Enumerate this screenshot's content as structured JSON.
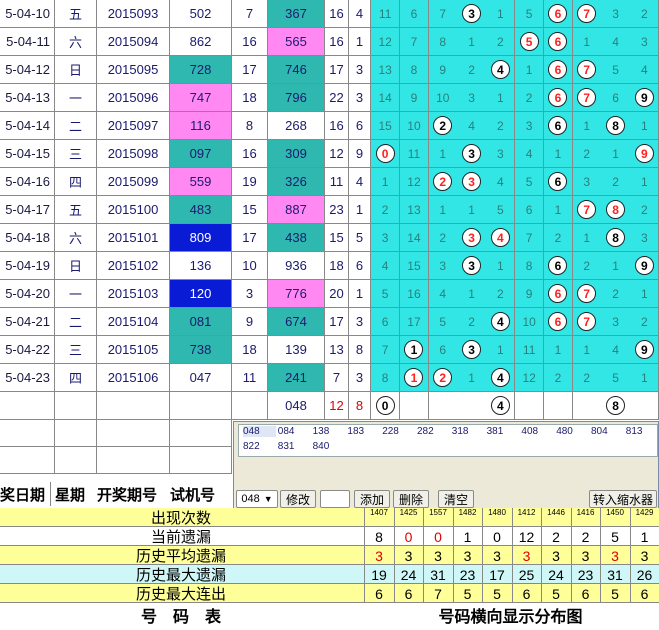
{
  "rows": [
    {
      "date": "5-04-10",
      "weekday": "五",
      "period": "2015093",
      "trial": "502",
      "trial_style": "white",
      "v1": "7",
      "win": "367",
      "win_style": "teal",
      "v2": "16",
      "v3": "4",
      "dist": [
        "11",
        "6",
        "7",
        "B3",
        "1",
        "5",
        "R6",
        "R7",
        "3",
        "2"
      ]
    },
    {
      "date": "5-04-11",
      "weekday": "六",
      "period": "2015094",
      "trial": "862",
      "trial_style": "white",
      "v1": "16",
      "win": "565",
      "win_style": "pink",
      "v2": "16",
      "v3": "1",
      "dist": [
        "12",
        "7",
        "8",
        "1",
        "2",
        "R5",
        "R6",
        "1",
        "4",
        "3"
      ]
    },
    {
      "date": "5-04-12",
      "weekday": "日",
      "period": "2015095",
      "trial": "728",
      "trial_style": "teal",
      "v1": "17",
      "win": "746",
      "win_style": "teal",
      "v2": "17",
      "v3": "3",
      "dist": [
        "13",
        "8",
        "9",
        "2",
        "B4",
        "1",
        "R6",
        "R7",
        "5",
        "4"
      ]
    },
    {
      "date": "5-04-13",
      "weekday": "一",
      "period": "2015096",
      "trial": "747",
      "trial_style": "pink",
      "v1": "18",
      "win": "796",
      "win_style": "teal",
      "v2": "22",
      "v3": "3",
      "dist": [
        "14",
        "9",
        "10",
        "3",
        "1",
        "2",
        "R6",
        "R7",
        "6",
        "B9"
      ]
    },
    {
      "date": "5-04-14",
      "weekday": "二",
      "period": "2015097",
      "trial": "116",
      "trial_style": "pink",
      "v1": "8",
      "win": "268",
      "win_style": "white",
      "v2": "16",
      "v3": "6",
      "dist": [
        "15",
        "10",
        "B2",
        "4",
        "2",
        "3",
        "B6",
        "1",
        "B8",
        "1"
      ]
    },
    {
      "date": "5-04-15",
      "weekday": "三",
      "period": "2015098",
      "trial": "097",
      "trial_style": "teal",
      "v1": "16",
      "win": "309",
      "win_style": "teal",
      "v2": "12",
      "v3": "9",
      "dist": [
        "R0",
        "11",
        "1",
        "B3",
        "3",
        "4",
        "1",
        "2",
        "1",
        "R9"
      ]
    },
    {
      "date": "5-04-16",
      "weekday": "四",
      "period": "2015099",
      "trial": "559",
      "trial_style": "pink",
      "v1": "19",
      "win": "326",
      "win_style": "teal",
      "v2": "11",
      "v3": "4",
      "dist": [
        "1",
        "12",
        "R2",
        "R3",
        "4",
        "5",
        "B6",
        "3",
        "2",
        "1"
      ]
    },
    {
      "date": "5-04-17",
      "weekday": "五",
      "period": "2015100",
      "trial": "483",
      "trial_style": "teal",
      "v1": "15",
      "win": "887",
      "win_style": "pink",
      "v2": "23",
      "v3": "1",
      "dist": [
        "2",
        "13",
        "1",
        "1",
        "5",
        "6",
        "1",
        "R7",
        "R8",
        "2"
      ]
    },
    {
      "date": "5-04-18",
      "weekday": "六",
      "period": "2015101",
      "trial": "809",
      "trial_style": "blue",
      "v1": "17",
      "win": "438",
      "win_style": "teal",
      "v2": "15",
      "v3": "5",
      "dist": [
        "3",
        "14",
        "2",
        "R3",
        "R4",
        "7",
        "2",
        "1",
        "B8",
        "3"
      ]
    },
    {
      "date": "5-04-19",
      "weekday": "日",
      "period": "2015102",
      "trial": "136",
      "trial_style": "white",
      "v1": "10",
      "win": "936",
      "win_style": "white",
      "v2": "18",
      "v3": "6",
      "dist": [
        "4",
        "15",
        "3",
        "B3",
        "1",
        "8",
        "B6",
        "2",
        "1",
        "B9"
      ]
    },
    {
      "date": "5-04-20",
      "weekday": "一",
      "period": "2015103",
      "trial": "120",
      "trial_style": "blue",
      "v1": "3",
      "win": "776",
      "win_style": "pink",
      "v2": "20",
      "v3": "1",
      "dist": [
        "5",
        "16",
        "4",
        "1",
        "2",
        "9",
        "R6",
        "R7",
        "2",
        "1"
      ]
    },
    {
      "date": "5-04-21",
      "weekday": "二",
      "period": "2015104",
      "trial": "081",
      "trial_style": "teal",
      "v1": "9",
      "win": "674",
      "win_style": "teal",
      "v2": "17",
      "v3": "3",
      "dist": [
        "6",
        "17",
        "5",
        "2",
        "B4",
        "10",
        "R6",
        "R7",
        "3",
        "2"
      ]
    },
    {
      "date": "5-04-22",
      "weekday": "三",
      "period": "2015105",
      "trial": "738",
      "trial_style": "teal",
      "v1": "18",
      "win": "139",
      "win_style": "white",
      "v2": "13",
      "v3": "8",
      "dist": [
        "7",
        "B1",
        "6",
        "B3",
        "1",
        "11",
        "1",
        "1",
        "4",
        "B9"
      ]
    },
    {
      "date": "5-04-23",
      "weekday": "四",
      "period": "2015106",
      "trial": "047",
      "trial_style": "white",
      "v1": "11",
      "win": "241",
      "win_style": "teal",
      "v2": "7",
      "v3": "3",
      "dist": [
        "8",
        "R1",
        "R2",
        "1",
        "B4",
        "12",
        "2",
        "2",
        "5",
        "1"
      ]
    }
  ],
  "pending_row": {
    "win": "048",
    "v2": "12",
    "v3": "8",
    "balls": [
      {
        "col": 0,
        "n": "0"
      },
      {
        "col": 4,
        "n": "4"
      },
      {
        "col": 8,
        "n": "8"
      }
    ]
  },
  "panel": {
    "numbers_row1": [
      "048",
      "084",
      "138",
      "183",
      "228",
      "282",
      "318",
      "381",
      "408",
      "480",
      "804",
      "813"
    ],
    "numbers_row2": [
      "822",
      "831",
      "840"
    ],
    "select_value": "048",
    "modify_label": "修改",
    "add_label": "添加",
    "delete_label": "删除",
    "clear_label": "清空",
    "shrink_label": "转入缩水器"
  },
  "headers": {
    "date": "奖日期",
    "weekday": "星期",
    "period": "开奖期号",
    "trial": "试机号"
  },
  "stats": [
    {
      "label": "出现次数",
      "values": [
        "1407",
        "1425",
        "1557",
        "1482",
        "1480",
        "1412",
        "1446",
        "1416",
        "1450",
        "1429"
      ],
      "tiny": true,
      "color": "#ffff99"
    },
    {
      "label": "当前遗漏",
      "values": [
        "8",
        "0",
        "0",
        "1",
        "0",
        "12",
        "2",
        "2",
        "5",
        "1"
      ],
      "color": "#ffffff"
    },
    {
      "label": "历史平均遗漏",
      "values": [
        "3",
        "3",
        "3",
        "3",
        "3",
        "3",
        "3",
        "3",
        "3",
        "3"
      ],
      "color": "#ffff99"
    },
    {
      "label": "历史最大遗漏",
      "values": [
        "19",
        "24",
        "31",
        "23",
        "17",
        "25",
        "24",
        "23",
        "31",
        "26"
      ],
      "color": "#cff7f7"
    },
    {
      "label": "历史最大连出",
      "values": [
        "6",
        "6",
        "7",
        "5",
        "5",
        "6",
        "5",
        "6",
        "5",
        "6"
      ],
      "color": "#ffff99"
    }
  ],
  "footer": {
    "left": "号　码　表",
    "right": "号码横向显示分布图"
  }
}
